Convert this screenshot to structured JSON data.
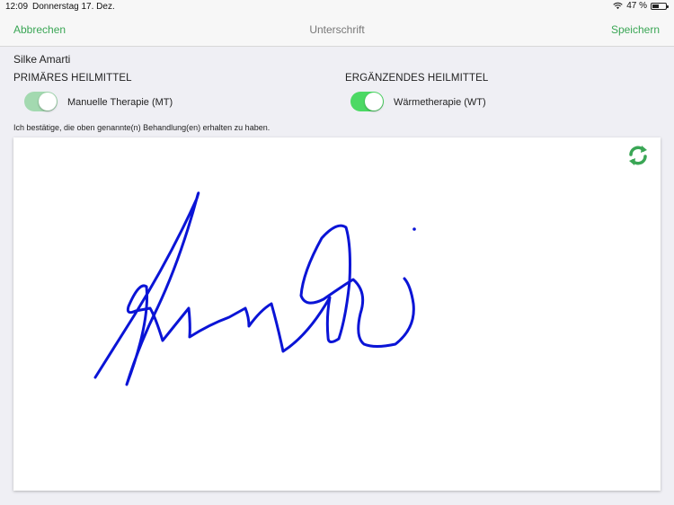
{
  "statusbar": {
    "time": "12:09",
    "date": "Donnerstag 17. Dez.",
    "battery": "47 %",
    "battery_level": 0.47
  },
  "navbar": {
    "cancel_label": "Abbrechen",
    "title": "Unterschrift",
    "save_label": "Speichern"
  },
  "patient_name": "Silke Amarti",
  "primary": {
    "heading": "PRIMÄRES HEILMITTEL",
    "label": "Manuelle Therapie (MT)",
    "enabled": true,
    "disabled_look": true
  },
  "secondary": {
    "heading": "ERGÄNZENDES HEILMITTEL",
    "label": "Wärmetherapie (WT)",
    "enabled": true
  },
  "confirmation_text": "Ich bestätige, die oben genannte(n) Behandlung(en) erhalten zu haben.",
  "icons": {
    "refresh": "refresh-icon",
    "wifi": "wifi-icon",
    "battery": "battery-icon"
  },
  "colors": {
    "accent": "#3aa655",
    "toggle_on": "#4cd964",
    "toggle_disabled": "#a3d9b0",
    "ink": "#0a14d6"
  }
}
